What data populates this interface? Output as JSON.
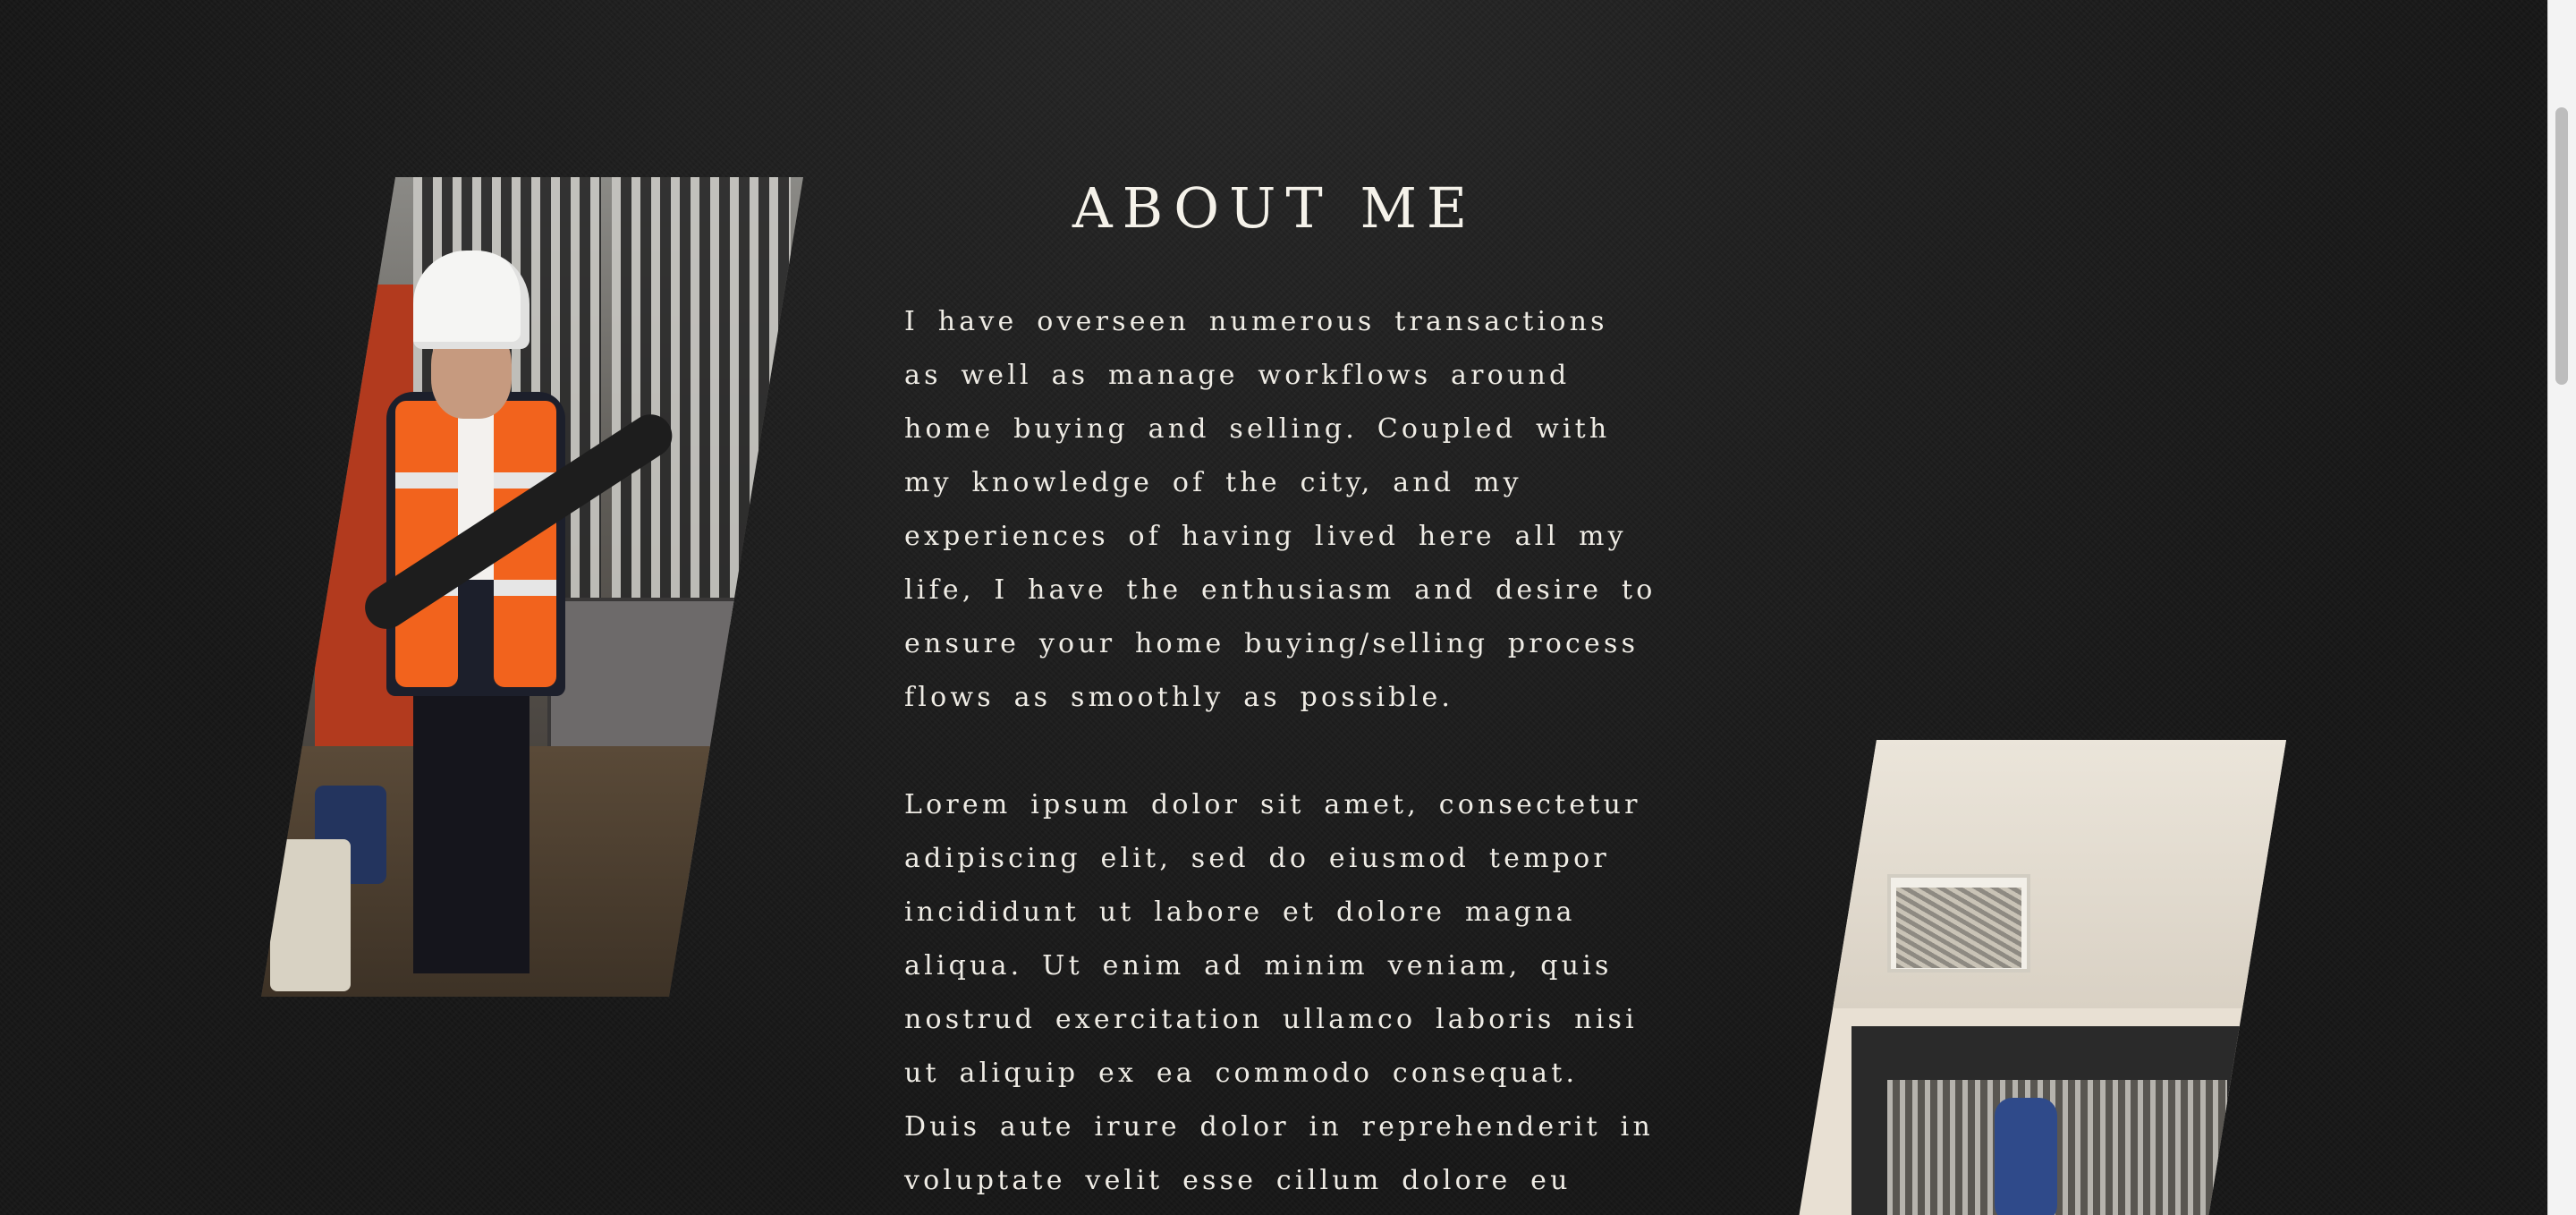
{
  "about": {
    "title": "ABOUT ME",
    "paragraph_1": "I have overseen numerous transactions as well as manage workflows around home buying and selling. Coupled with my knowledge of the city, and my experiences of having lived here all my life, I have the enthusiasm and desire to ensure your home buying/selling process flows as smoothly as possible.",
    "paragraph_2": "Lorem ipsum dolor sit amet, consectetur adipiscing elit, sed do eiusmod tempor incididunt ut labore et dolore magna aliqua. Ut enim ad minim veniam, quis nostrud exercitation ullamco laboris nisi ut aliquip ex ea commodo consequat. Duis aute irure dolor in reprehenderit in voluptate velit esse cillum dolore eu fugiat"
  },
  "colors": {
    "background": "#181818",
    "text": "#efece5",
    "vest": "#f2631d"
  },
  "images": {
    "left": "photo-agent-hard-hat",
    "right": "photo-interior-ceiling"
  }
}
